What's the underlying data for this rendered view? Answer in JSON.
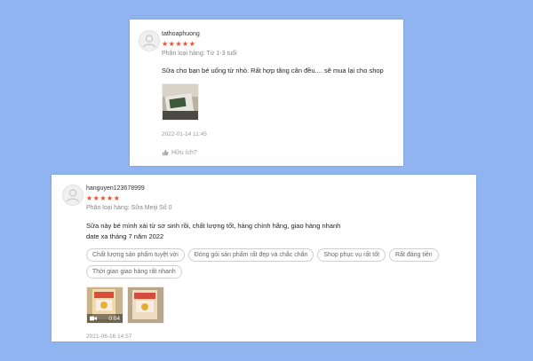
{
  "reviews": [
    {
      "username": "tathoaphuong",
      "stars": "★★★★★",
      "variation": "Phân loại hàng: Từ 1-3 tuổi",
      "text_lines": [
        "Sữa cho bạn bé uống từ nhỏ. Rất hợp tăng cân đều.... sẽ mua lại cho shop"
      ],
      "time": "2022-01-14 11:45",
      "helpful_label": "Hữu ích?"
    },
    {
      "username": "hanguyen123678999",
      "stars": "★★★★★",
      "variation": "Phân loại hàng: Sữa Meiji Số 0",
      "text_lines": [
        "Sữa này bé mình xài từ sơ sinh rồi, chất lượng tốt, hàng chính hãng, giao hàng nhanh",
        "date xa tháng 7 năm 2022"
      ],
      "tags": [
        "Chất lượng sản phẩm tuyệt vời",
        "Đóng gói sản phẩm rất đẹp và chắc chắn",
        "Shop phục vụ rất tốt",
        "Rất đáng tiền",
        "Thời gian giao hàng rất nhanh"
      ],
      "video_duration": "0:04",
      "time": "2021-06-16 14:57"
    }
  ],
  "colors": {
    "background": "#8fb4f0",
    "star": "#ee4d2d"
  },
  "icons": {
    "avatar": "user-avatar-icon",
    "like": "thumbs-up-icon",
    "video": "video-camera-icon"
  }
}
